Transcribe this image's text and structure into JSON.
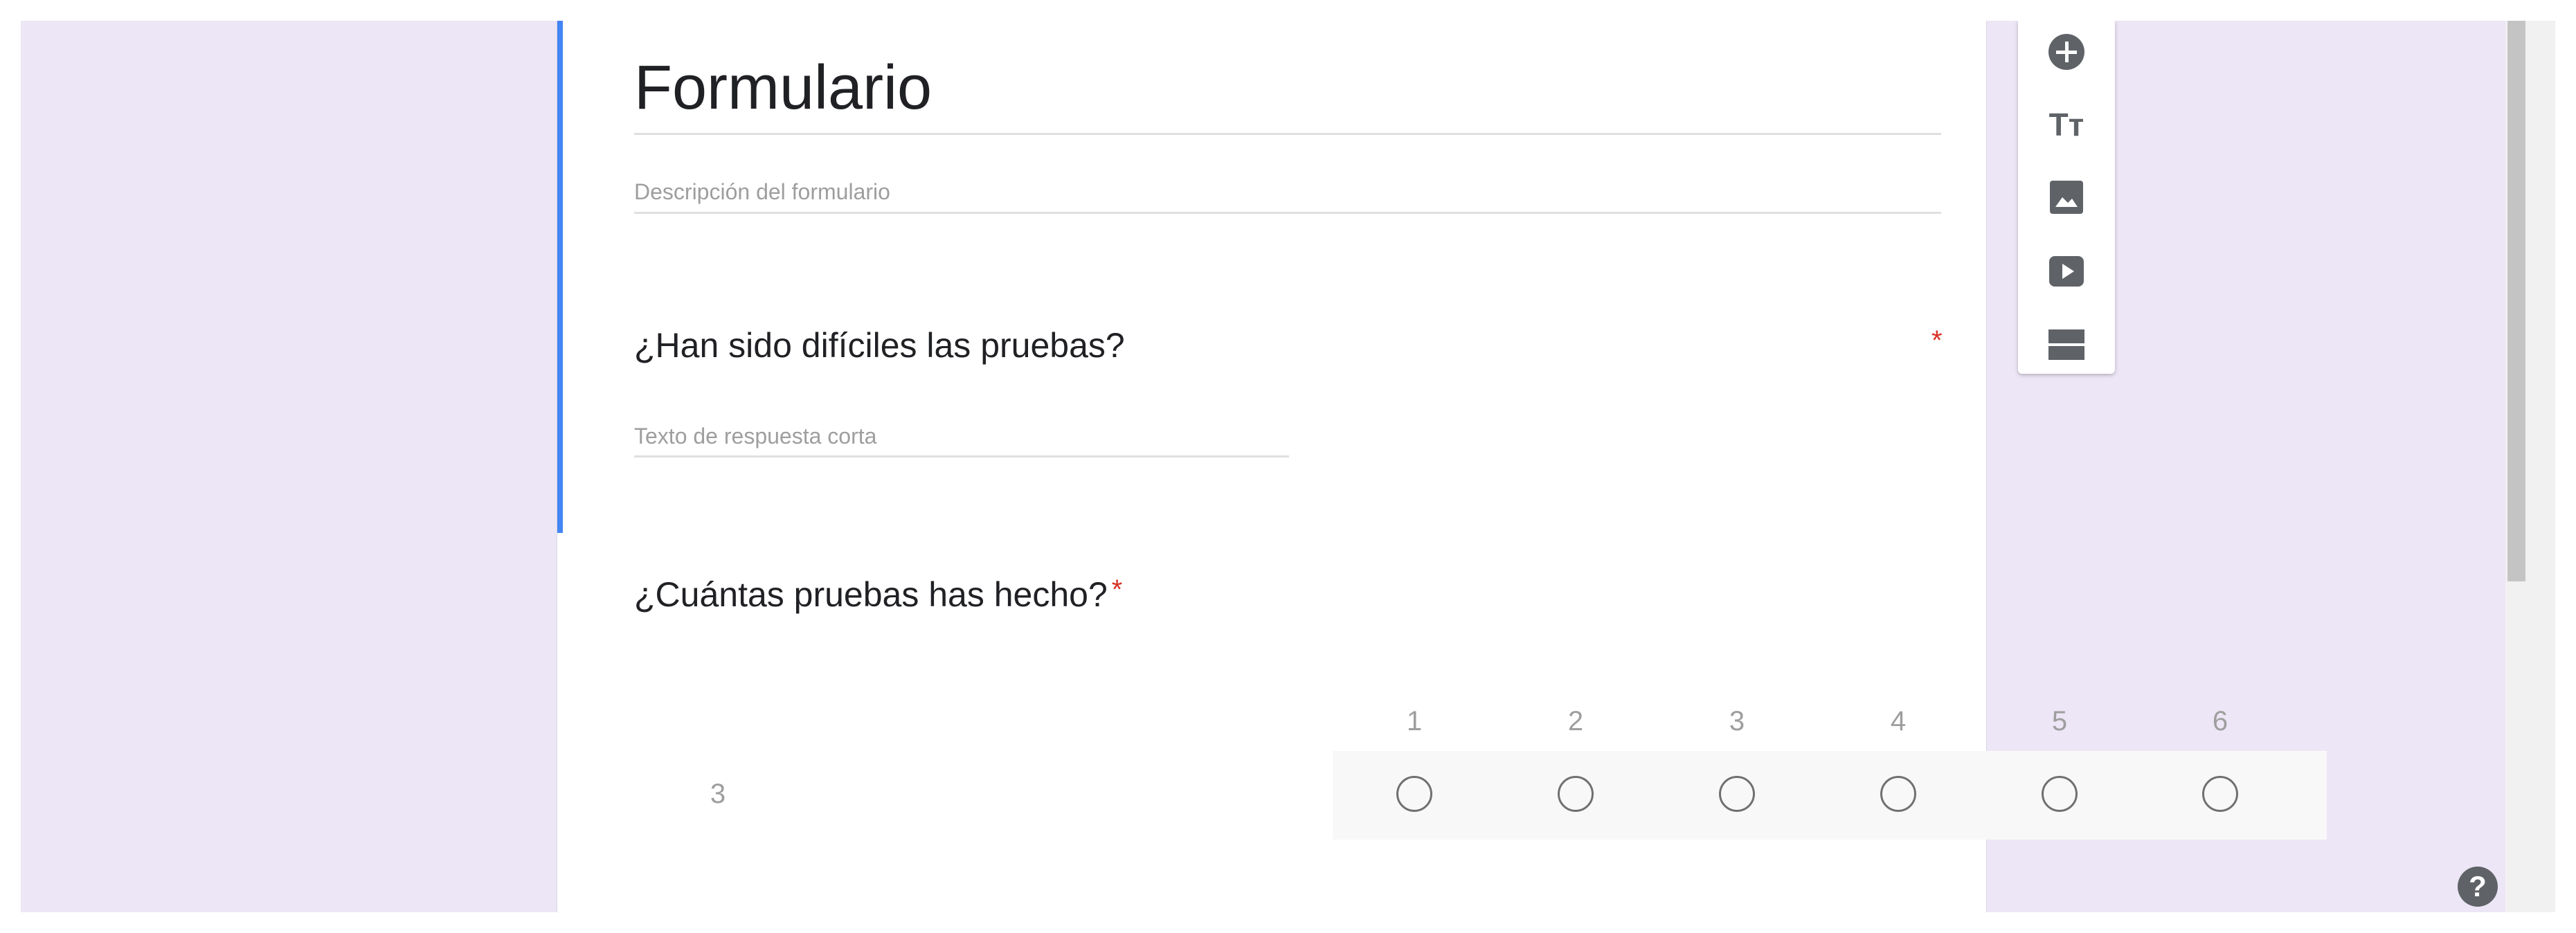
{
  "form": {
    "title": "Formulario",
    "description_placeholder": "Descripción del formulario"
  },
  "questions": [
    {
      "title": "¿Han sido difíciles las pruebas?",
      "required_mark": "*",
      "answer_placeholder": "Texto de respuesta corta"
    },
    {
      "title": "¿Cuántas pruebas has hecho?",
      "required_mark": "*",
      "grid": {
        "columns": [
          "1",
          "2",
          "3",
          "4",
          "5",
          "6"
        ],
        "rows": [
          "3"
        ]
      }
    }
  ],
  "toolbar": {
    "tools": [
      "add-question-icon",
      "add-title-icon",
      "add-image-icon",
      "add-video-icon",
      "add-section-icon"
    ],
    "title_glyph": "Tт"
  },
  "help": {
    "glyph": "?"
  },
  "colors": {
    "accent": "#4285f4",
    "background": "#ede6f6",
    "required": "#d93025"
  }
}
